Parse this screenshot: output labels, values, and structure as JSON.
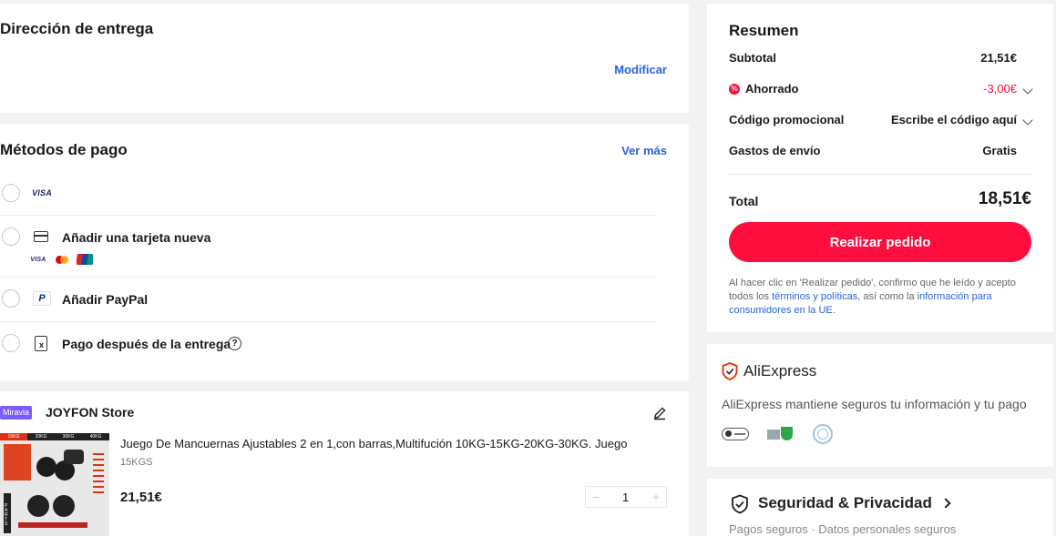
{
  "delivery": {
    "title": "Dirección de entrega",
    "modify_label": "Modificar"
  },
  "payment": {
    "title": "Métodos de pago",
    "see_more_label": "Ver más",
    "visa_text": "VISA",
    "add_card_label": "Añadir una tarjeta nueva",
    "add_paypal_label": "Añadir PayPal",
    "pay_after_label": "Pago después de la entrega"
  },
  "store": {
    "badge": "Miravia",
    "name": "JOYFON Store",
    "product": {
      "title": "Juego De Mancuernas Ajustables 2 en 1,con barras,Multifución 10KG-15KG-20KG-30KG. Juego",
      "variant": "15KGS",
      "price": "21,51€",
      "quantity": "1",
      "image_labels": [
        "15KG",
        "20KG",
        "30KG",
        "40KG"
      ],
      "image_side_text": "PARTS"
    }
  },
  "summary": {
    "title": "Resumen",
    "subtotal_label": "Subtotal",
    "subtotal_value": "21,51€",
    "saved_label": "Ahorrado",
    "saved_value": "-3,00€",
    "promo_label": "Código promocional",
    "promo_value": "Escribe el código aquí",
    "shipping_label": "Gastos de envío",
    "shipping_value": "Gratis",
    "total_label": "Total",
    "total_value": "18,51€",
    "place_order_label": "Realizar pedido",
    "disclaimer_1": "Al hacer clic en 'Realizar pedido', confirmo que he leído y acepto todos los ",
    "terms_link": "términos y políticas",
    "disclaimer_2": ", así como la ",
    "info_link": "información para consumidores en la UE",
    "disclaimer_3": ".",
    "saved_color": "#fd0e3d"
  },
  "trust": {
    "brand": "AliExpress",
    "text": "AliExpress mantiene seguros tu información y tu pago"
  },
  "security": {
    "title": "Seguridad & Privacidad",
    "subtitle": "Pagos seguros · Datos personales seguros"
  },
  "colors": {
    "accent": "#fd0e3d",
    "link": "#2962d9"
  }
}
